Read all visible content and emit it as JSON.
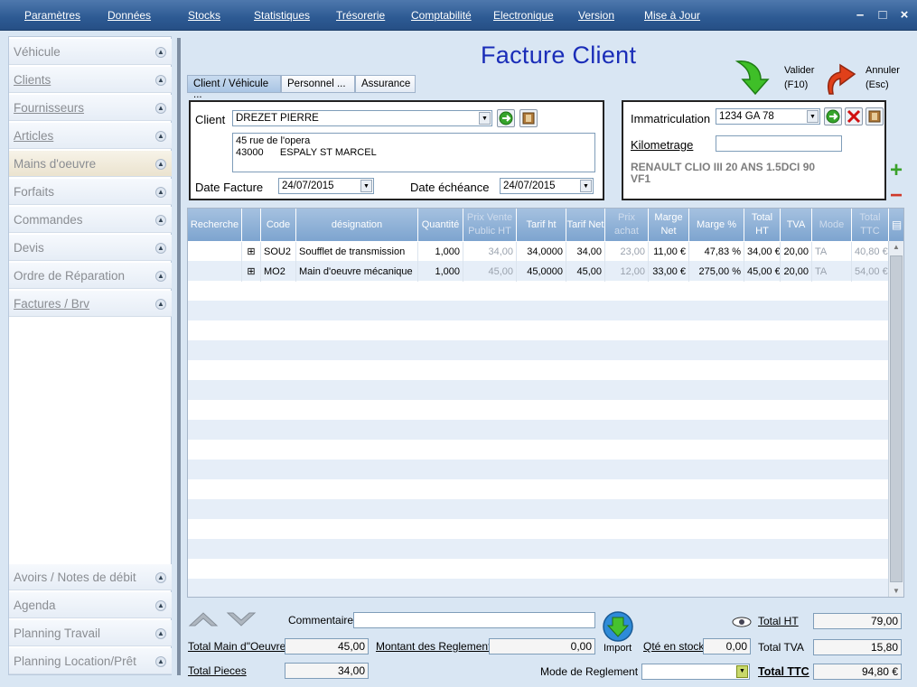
{
  "menu": [
    "Paramètres",
    "Données",
    "Stocks",
    "Statistiques",
    "Trésorerie",
    "Comptabilité",
    "Electronique",
    "Version",
    "Mise à Jour"
  ],
  "window_controls": {
    "minimize": "–",
    "maximize": "□",
    "close": "×"
  },
  "sidebar": {
    "top_items": [
      "Véhicule",
      "Clients",
      "Fournisseurs",
      "Articles",
      "Mains d'oeuvre",
      "Forfaits",
      "Commandes",
      "Devis",
      "Ordre de Réparation",
      "Factures / Brv"
    ],
    "bottom_items": [
      "Avoirs / Notes de débit",
      "Agenda",
      "Planning Travail",
      "Planning Location/Prêt"
    ],
    "active": "Mains d'oeuvre"
  },
  "title": "Facture Client",
  "actions": {
    "validate_label": "Valider",
    "validate_key": "(F10)",
    "cancel_label": "Annuler",
    "cancel_key": "(Esc)"
  },
  "tabs": [
    "Client / Véhicule ...",
    "Personnel  ...",
    "Assurance"
  ],
  "client_panel": {
    "client_label": "Client",
    "client_value": "DREZET PIERRE",
    "address_line1": "45 rue de l'opera",
    "address_line2": "43000      ESPALY ST MARCEL",
    "date_facture_label": "Date Facture",
    "date_facture": "24/07/2015",
    "date_echeance_label": "Date échéance",
    "date_echeance": "24/07/2015"
  },
  "vehicle_panel": {
    "immat_label": "Immatriculation",
    "immat_value": "1234 GA 78",
    "km_label": "Kilometrage",
    "km_value": "",
    "model_line1": "RENAULT CLIO III 20 ANS 1.5DCI 90",
    "model_line2": "VF1"
  },
  "side_buttons": {
    "add": "+",
    "remove": "−"
  },
  "grid": {
    "headers": [
      "Recherche",
      "",
      "Code",
      "désignation",
      "Quantité",
      "Prix Vente Public HT",
      "Tarif ht",
      "Tarif Net",
      "Prix achat",
      "Marge Net",
      "Marge %",
      "Total HT",
      "TVA",
      "Mode",
      "Total TTC"
    ],
    "rows": [
      {
        "code": "SOU2",
        "designation": "Soufflet de transmission",
        "quantite": "1,000",
        "prix_public": "34,00",
        "tarif_ht": "34,0000",
        "tarif_net": "34,00",
        "prix_achat": "23,00",
        "marge_net": "11,00 €",
        "marge_pct": "47,83 %",
        "total_ht": "34,00 €",
        "tva": "20,00",
        "mode": "TA",
        "total_ttc": "40,80 €"
      },
      {
        "code": "MO2",
        "designation": "Main d'oeuvre mécanique",
        "quantite": "1,000",
        "prix_public": "45,00",
        "tarif_ht": "45,0000",
        "tarif_net": "45,00",
        "prix_achat": "12,00",
        "marge_net": "33,00 €",
        "marge_pct": "275,00 %",
        "total_ht": "45,00 €",
        "tva": "20,00",
        "mode": "TA",
        "total_ttc": "54,00 €"
      }
    ]
  },
  "footer": {
    "commentaire_label": "Commentaire",
    "commentaire_value": "",
    "total_mo_label": "Total Main d\"Oeuvre",
    "total_mo": "45,00",
    "total_pieces_label": "Total Pieces",
    "total_pieces": "34,00",
    "montant_label": "Montant des Reglements",
    "montant": "0,00",
    "import_label": "Import",
    "qte_stock_label": "Qté en stock",
    "qte_stock": "0,00",
    "mode_reglement_label": "Mode de Reglement :",
    "mode_reglement": "",
    "total_ht_label": "Total HT",
    "total_ht": "79,00",
    "total_tva_label": "Total TVA",
    "total_tva": "15,80",
    "total_ttc_label": "Total TTC",
    "total_ttc": "94,80 €"
  },
  "colors": {
    "menubar": "#2d5a93",
    "title": "#1a2db8",
    "validate_arrow": "#3fbf28",
    "cancel_arrow": "#e0401a",
    "grid_header": "#8fb0d6"
  },
  "icons": [
    "search-icon",
    "eye-icon",
    "import-icon",
    "validate-arrow-icon",
    "cancel-arrow-icon",
    "up-arrow-icon",
    "down-arrow-icon"
  ]
}
